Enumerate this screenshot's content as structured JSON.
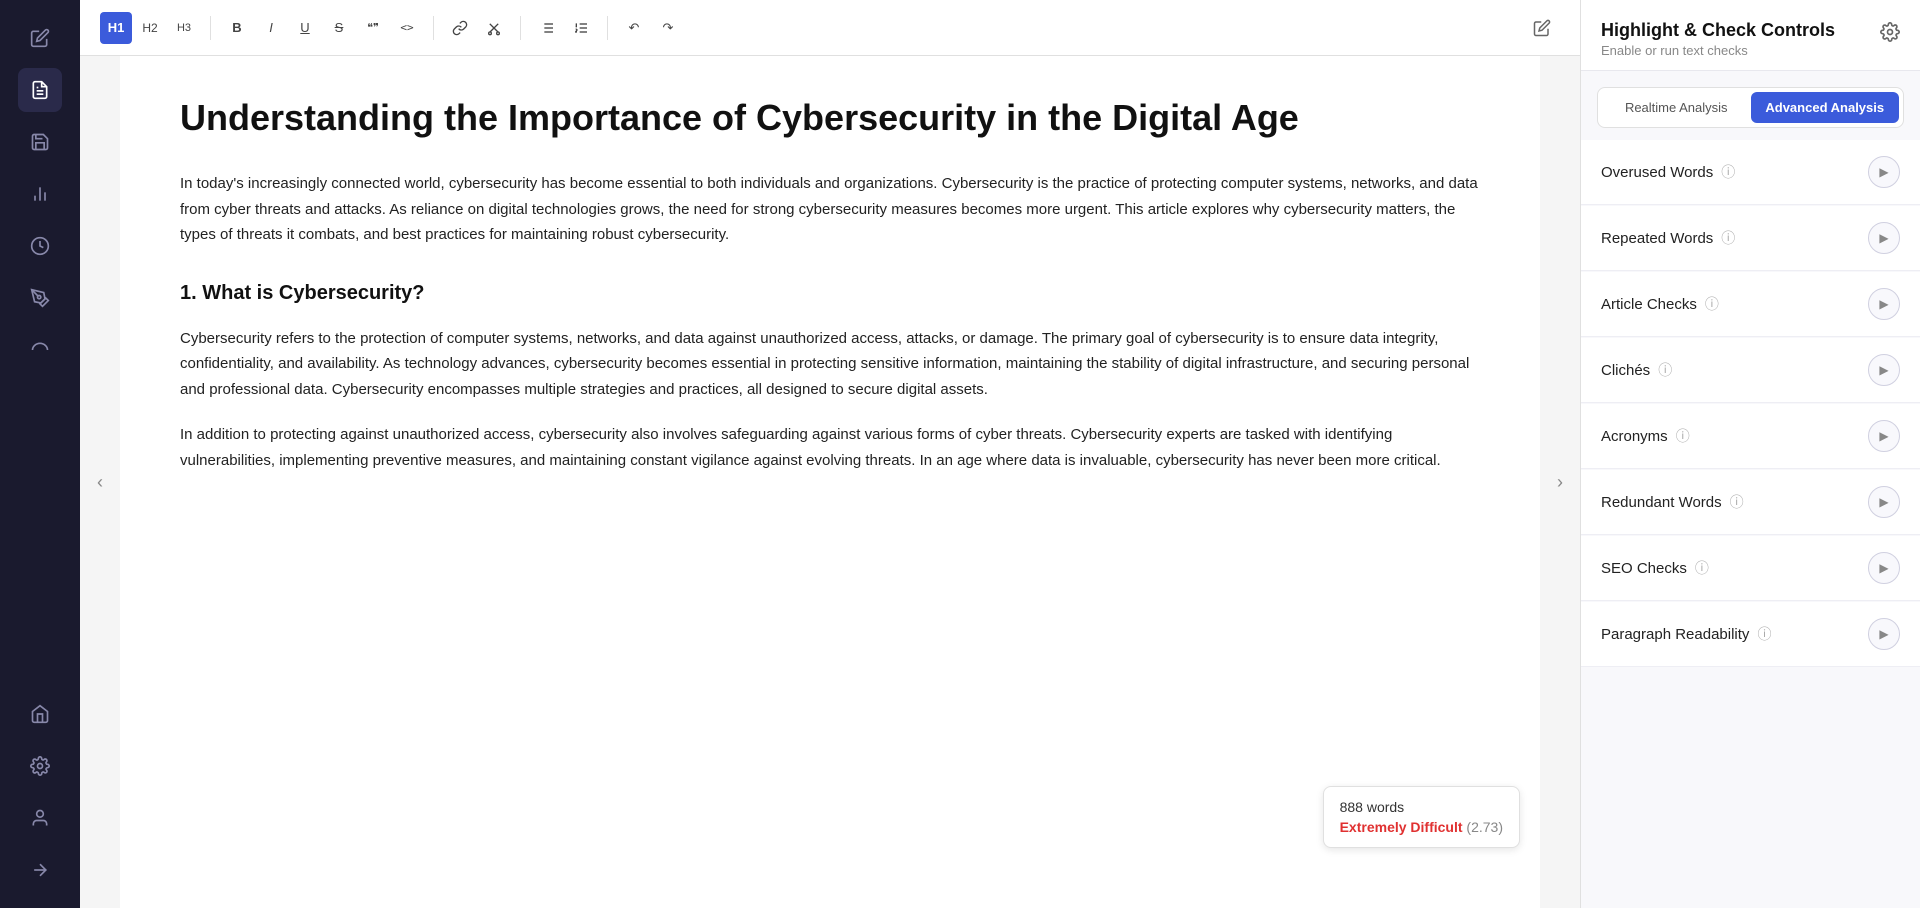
{
  "sidebar": {
    "icons": [
      {
        "name": "edit-icon",
        "symbol": "✏️",
        "active": false
      },
      {
        "name": "document-icon",
        "symbol": "📄",
        "active": true
      },
      {
        "name": "save-icon",
        "symbol": "💾",
        "active": false
      },
      {
        "name": "chart-icon",
        "symbol": "📊",
        "active": false
      },
      {
        "name": "analytics-icon",
        "symbol": "📈",
        "active": false
      },
      {
        "name": "highlight-icon",
        "symbol": "🖊️",
        "active": false
      },
      {
        "name": "curve-icon",
        "symbol": "〰️",
        "active": false
      },
      {
        "name": "home-icon",
        "symbol": "🏠",
        "active": false
      },
      {
        "name": "settings-icon",
        "symbol": "⚙️",
        "active": false
      },
      {
        "name": "user-icon",
        "symbol": "👤",
        "active": false
      },
      {
        "name": "arrow-icon",
        "symbol": "→",
        "active": false
      }
    ]
  },
  "toolbar": {
    "h1_label": "H1",
    "h2_label": "H2",
    "h3_label": "H3",
    "bold_label": "B",
    "italic_label": "I",
    "underline_label": "U",
    "strikethrough_label": "S",
    "quote_label": "\"\"",
    "code_label": "<>",
    "link_label": "🔗",
    "cut_label": "✂",
    "bullet_label": "☰",
    "numbered_label": "≡",
    "undo_label": "↶",
    "redo_label": "↷",
    "edit_icon_label": "✎"
  },
  "article": {
    "title": "Understanding the Importance of Cybersecurity in the Digital Age",
    "paragraphs": [
      "In today's increasingly connected world, cybersecurity has become essential to both individuals and organizations. Cybersecurity is the practice of protecting computer systems, networks, and data from cyber threats and attacks. As reliance on digital technologies grows, the need for strong cybersecurity measures becomes more urgent. This article explores why cybersecurity matters, the types of threats it combats, and best practices for maintaining robust cybersecurity.",
      "1. What is Cybersecurity?",
      "Cybersecurity refers to the protection of computer systems, networks, and data against unauthorized access, attacks, or damage. The primary goal of cybersecurity is to ensure data integrity, confidentiality, and availability. As technology advances, cybersecurity becomes essential in protecting sensitive information, maintaining the stability of digital infrastructure, and securing personal and professional data. Cybersecurity encompasses multiple strategies and practices, all designed to secure digital assets.",
      "In addition to protecting against unauthorized access, cybersecurity also involves safeguarding against various forms of cyber threats. Cybersecurity experts are tasked with identifying vulnerabilities, implementing preventive measures, and maintaining constant vigilance against evolving threats. In an age where data is invaluable, cybersecurity has never been more critical."
    ],
    "word_count": "888 words",
    "difficulty_label": "Extremely Difficult",
    "difficulty_color": "#e03131",
    "difficulty_score": "(2.73)"
  },
  "right_panel": {
    "title": "Highlight & Check Controls",
    "subtitle": "Enable or run text checks",
    "settings_icon": "⚙",
    "tabs": [
      {
        "label": "Realtime Analysis",
        "active": false
      },
      {
        "label": "Advanced Analysis",
        "active": true
      }
    ],
    "checks": [
      {
        "label": "Overused Words",
        "has_info": true
      },
      {
        "label": "Repeated Words",
        "has_info": true
      },
      {
        "label": "Article Checks",
        "has_info": true
      },
      {
        "label": "Clichés",
        "has_info": true
      },
      {
        "label": "Acronyms",
        "has_info": true
      },
      {
        "label": "Redundant Words",
        "has_info": true
      },
      {
        "label": "SEO Checks",
        "has_info": true
      },
      {
        "label": "Paragraph Readability",
        "has_info": true
      }
    ]
  }
}
